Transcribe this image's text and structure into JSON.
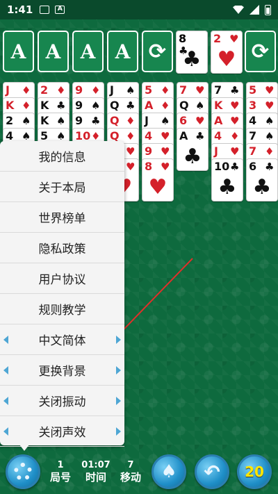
{
  "status_bar": {
    "time": "1:41",
    "icon_a": "A"
  },
  "foundations": [
    {
      "label": "A"
    },
    {
      "label": "A"
    },
    {
      "label": "A"
    },
    {
      "label": "A"
    }
  ],
  "recycle_symbol": "⟳",
  "waste": [
    {
      "rank": "8",
      "suit": "♣",
      "color": "black"
    },
    {
      "rank": "2",
      "suit": "♥",
      "color": "red"
    }
  ],
  "columns": [
    [
      {
        "rank": "J",
        "suit": "♦",
        "color": "red"
      },
      {
        "rank": "K",
        "suit": "♦",
        "color": "red"
      },
      {
        "rank": "2",
        "suit": "♠",
        "color": "black"
      },
      {
        "rank": "4",
        "suit": "♠",
        "color": "black"
      }
    ],
    [
      {
        "rank": "2",
        "suit": "♦",
        "color": "red"
      },
      {
        "rank": "K",
        "suit": "♣",
        "color": "black"
      },
      {
        "rank": "K",
        "suit": "♠",
        "color": "black"
      },
      {
        "rank": "5",
        "suit": "♠",
        "color": "black"
      }
    ],
    [
      {
        "rank": "9",
        "suit": "♦",
        "color": "red"
      },
      {
        "rank": "9",
        "suit": "♠",
        "color": "black"
      },
      {
        "rank": "9",
        "suit": "♣",
        "color": "black"
      },
      {
        "rank": "10",
        "suit": "♦",
        "color": "red"
      }
    ],
    [
      {
        "rank": "J",
        "suit": "♠",
        "color": "black"
      },
      {
        "rank": "Q",
        "suit": "♣",
        "color": "black"
      },
      {
        "rank": "Q",
        "suit": "♦",
        "color": "red"
      },
      {
        "rank": "Q",
        "suit": "♦",
        "color": "red"
      },
      {
        "rank": "",
        "suit": "♥",
        "color": "red"
      },
      {
        "rank": "",
        "suit": "♥",
        "color": "red"
      }
    ],
    [
      {
        "rank": "5",
        "suit": "♦",
        "color": "red"
      },
      {
        "rank": "A",
        "suit": "♦",
        "color": "red"
      },
      {
        "rank": "J",
        "suit": "♠",
        "color": "black"
      },
      {
        "rank": "4",
        "suit": "♥",
        "color": "red"
      },
      {
        "rank": "9",
        "suit": "♥",
        "color": "red"
      },
      {
        "rank": "8",
        "suit": "♥",
        "color": "red"
      }
    ],
    [
      {
        "rank": "7",
        "suit": "♥",
        "color": "red"
      },
      {
        "rank": "Q",
        "suit": "♠",
        "color": "black"
      },
      {
        "rank": "6",
        "suit": "♥",
        "color": "red"
      },
      {
        "rank": "A",
        "suit": "♣",
        "color": "black"
      }
    ],
    [
      {
        "rank": "7",
        "suit": "♣",
        "color": "black"
      },
      {
        "rank": "K",
        "suit": "♥",
        "color": "red"
      },
      {
        "rank": "A",
        "suit": "♥",
        "color": "red"
      },
      {
        "rank": "4",
        "suit": "♦",
        "color": "red"
      },
      {
        "rank": "J",
        "suit": "♥",
        "color": "red"
      },
      {
        "rank": "10",
        "suit": "♣",
        "color": "black"
      }
    ],
    [
      {
        "rank": "5",
        "suit": "♥",
        "color": "red"
      },
      {
        "rank": "3",
        "suit": "♥",
        "color": "red"
      },
      {
        "rank": "4",
        "suit": "♠",
        "color": "black"
      },
      {
        "rank": "7",
        "suit": "♠",
        "color": "black"
      },
      {
        "rank": "7",
        "suit": "♦",
        "color": "red"
      },
      {
        "rank": "6",
        "suit": "♣",
        "color": "black"
      }
    ]
  ],
  "menu": {
    "items": [
      {
        "label": "我的信息",
        "arrows": false
      },
      {
        "label": "关于本局",
        "arrows": false
      },
      {
        "label": "世界榜单",
        "arrows": false
      },
      {
        "label": "隐私政策",
        "arrows": false
      },
      {
        "label": "用户协议",
        "arrows": false
      },
      {
        "label": "规则教学",
        "arrows": false
      },
      {
        "label": "中文简体",
        "arrows": true
      },
      {
        "label": "更换背景",
        "arrows": true
      },
      {
        "label": "关闭振动",
        "arrows": true
      },
      {
        "label": "关闭声效",
        "arrows": true
      }
    ]
  },
  "bottom": {
    "game_no": {
      "value": "1",
      "label": "局号"
    },
    "time": {
      "value": "01:07",
      "label": "时间"
    },
    "moves": {
      "value": "7",
      "label": "移动"
    },
    "hint_count": "20"
  },
  "colors": {
    "felt": "#0e6a3e",
    "red_suit": "#d4202a",
    "accent_blue": "#1f8fc8",
    "annotation": "#e0302a"
  }
}
